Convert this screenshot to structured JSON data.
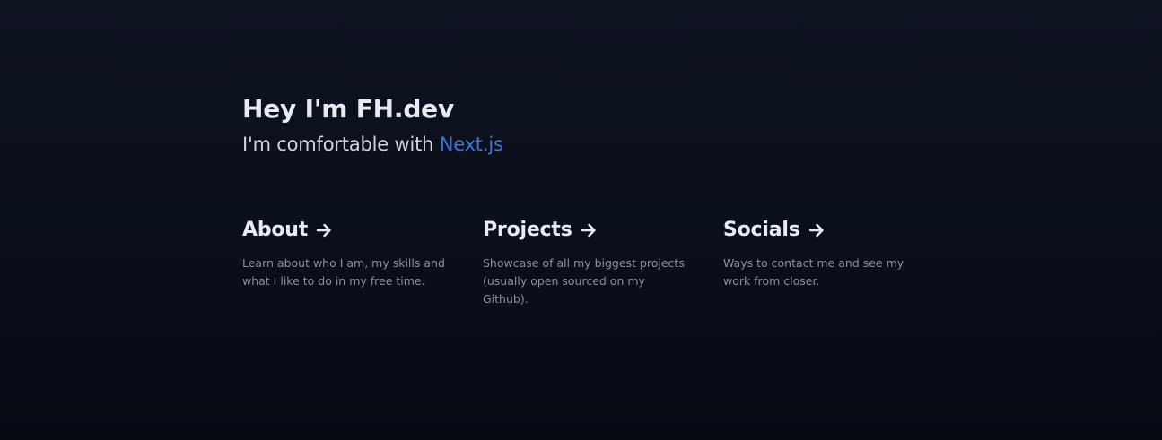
{
  "hero": {
    "title": "Hey I'm FH.dev",
    "subtitle_prefix": "I'm comfortable with ",
    "subtitle_tech": "Next.js"
  },
  "colors": {
    "accent": "#3b76d4",
    "background": "#0b101c",
    "muted_text": "#8a909c"
  },
  "cards": [
    {
      "title": "About",
      "icon": "arrow-right-icon",
      "description": "Learn about who I am, my skills and what I like to do in my free time."
    },
    {
      "title": "Projects",
      "icon": "arrow-right-icon",
      "description": "Showcase of all my biggest projects (usually open sourced on my Github)."
    },
    {
      "title": "Socials",
      "icon": "arrow-right-icon",
      "description": "Ways to contact me and see my work from closer."
    }
  ]
}
